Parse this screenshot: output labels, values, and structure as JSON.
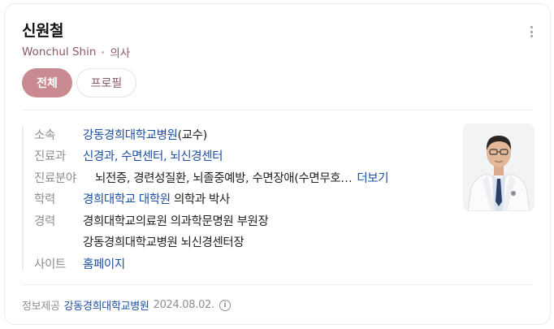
{
  "profile": {
    "name": "신원철",
    "english_name": "Wonchul Shin",
    "role": "의사"
  },
  "tabs": [
    {
      "label": "전체",
      "active": true
    },
    {
      "label": "프로필",
      "active": false
    }
  ],
  "info": {
    "affiliation": {
      "label": "소속",
      "hospital": "강동경희대학교병원",
      "position": "(교수)"
    },
    "department": {
      "label": "진료과",
      "value": "신경과, 수면센터, 뇌신경센터"
    },
    "specialty": {
      "label": "진료분야",
      "value": "뇌전증, 경련성질환, 뇌졸중예방, 수면장애(수면무호…",
      "more": "더보기"
    },
    "education": {
      "label": "학력",
      "school": "경희대학교 대학원",
      "degree": "의학과 박사"
    },
    "career": {
      "label": "경력",
      "items": [
        "경희대학교의료원 의과학문명원 부원장",
        "강동경희대학교병원 뇌신경센터장"
      ]
    },
    "site": {
      "label": "사이트",
      "value": "홈페이지"
    }
  },
  "footer": {
    "provider_label": "정보제공",
    "provider": "강동경희대학교병원",
    "date": "2024.08.02."
  },
  "colors": {
    "accent": "#c98a92",
    "link": "#1c4fa3",
    "subtle_text": "#8e8e93"
  }
}
